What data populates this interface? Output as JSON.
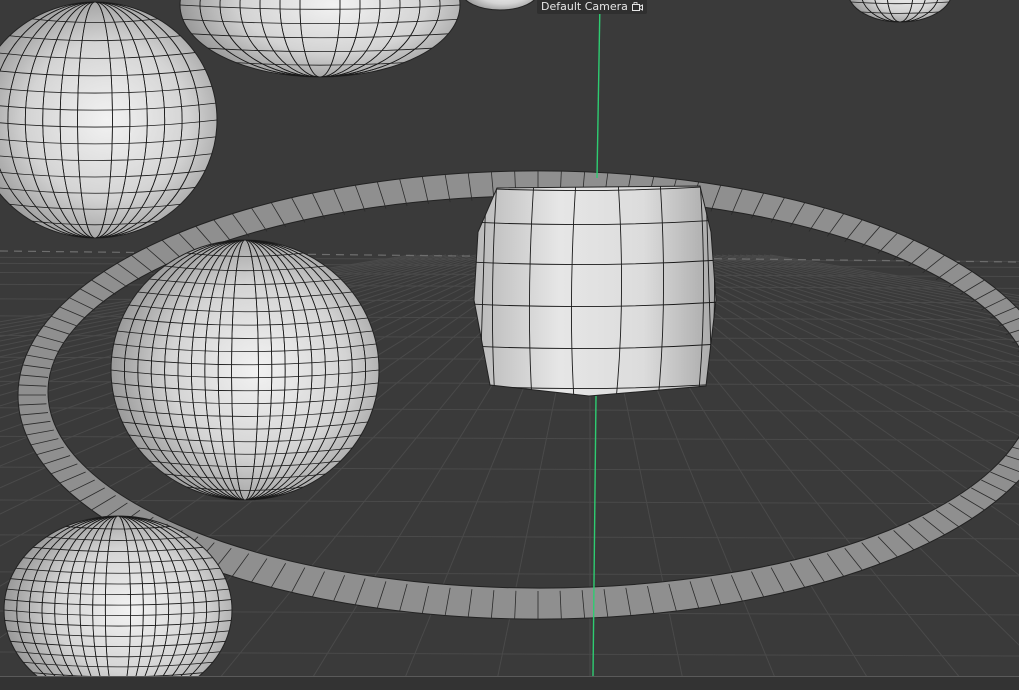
{
  "viewport": {
    "camera_label": "Default Camera",
    "camera_icon": "camera-icon",
    "background_color": "#3a3a3a",
    "y_axis_color": "#2ecc71",
    "grid_color": "#4a4a4a",
    "surface_color": "#c8c8c8",
    "wire_color": "#111111"
  }
}
